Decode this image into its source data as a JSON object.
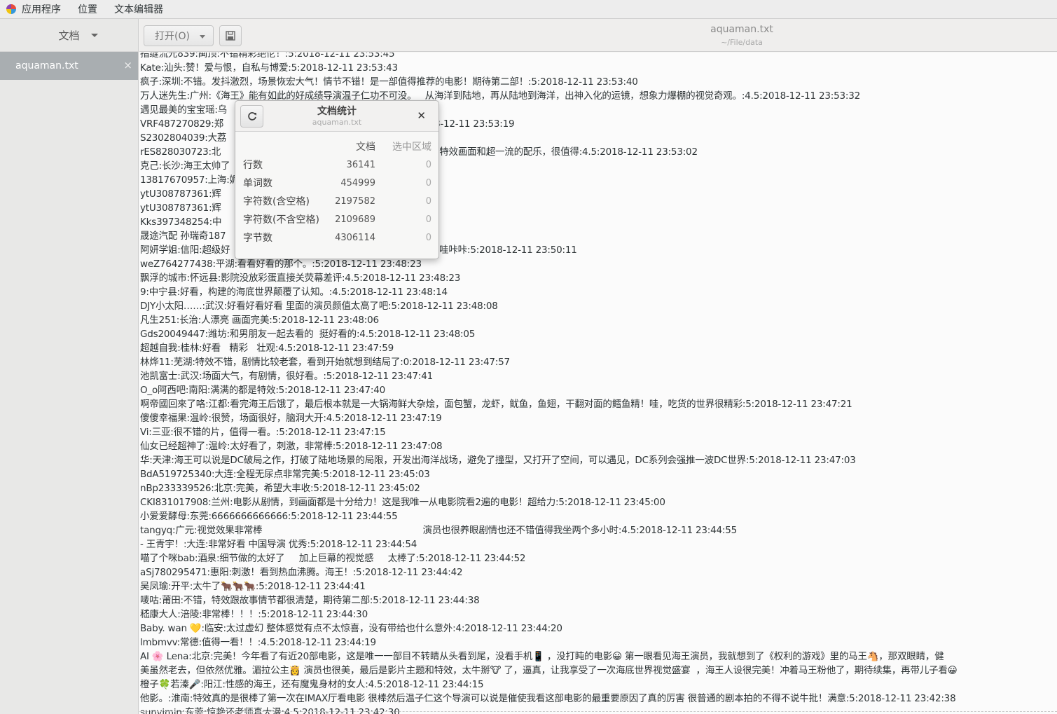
{
  "topbar": {
    "menus": [
      "应用程序",
      "位置",
      "文本编辑器"
    ]
  },
  "sidebar": {
    "header_label": "文档",
    "documents": [
      {
        "name": "aquaman.txt"
      }
    ]
  },
  "header": {
    "open_label": "打开(O)",
    "title": "aquaman.txt",
    "subtitle": "~/File/data"
  },
  "editor": {
    "lines": [
      "指缝流光839:闽顶:不错精彩绝伦！:5:2018-12-11 23:53:45",
      "Kate:汕头:赞！爱与恨，自私与博爱:5:2018-12-11 23:53:43",
      "疯子:深圳:不错。发抖激烈，场景恢宏大气！情节不错！是一部值得推荐的电影！期待第二部！:5:2018-12-11 23:53:40",
      "万人迷先生:广州:《海王》能有如此的好成绩导演温子仁功不可没。   从海洋到陆地，再从陆地到海洋，出神入化的运镜，想象力爆棚的视觉奇观。:4.5:2018-12-11 23:53:32",
      "遇见最美的宝宝瑶:乌                                            25",
      "VRF487270829:郑                                               影真不错，:5:2018-12-11 23:53:19",
      "S2302804039:大荔                                              23:53:07",
      "rES828030723:北                                               尼带水，加上精致的特效画面和超一流的配乐，很值得:4.5:2018-12-11 23:53:02",
      "克己:长沙:海王太帅了",
      "13817670957:上海:妮",
      "ytU308787361:辉                                               3:51:13",
      "ytU308787361:辉                                               3:51:07",
      "Kks397348254:中",
      "晟途汽配 孙瑞奇187                                            -12-11 23:50:17",
      "阿妍学姐:信阳:超级好                                          比较奈斯  强烈推荐   哇咔咔:5:2018-12-11 23:50:11",
      "weZ764277438:平湖:看看好看的那个。:5:2018-12-11 23:48:23",
      "飘浮的城市:怀远县:影院没放彩蛋直接关荧幕差评:4.5:2018-12-11 23:48:23",
      "9:中宁县:好看，构建的海底世界颠覆了认知。:4.5:2018-12-11 23:48:14",
      "DJY小太阳……:武汉:好看好看好看 里面的演员颜值太高了吧:5:2018-12-11 23:48:08",
      "凡生251:长治:人漂亮 画面完美:5:2018-12-11 23:48:06",
      "Gds20049447:潍坊:和男朋友一起去看的  挺好看的:4.5:2018-12-11 23:48:05",
      "超越自我:桂林:好看   精彩   壮观:4.5:2018-12-11 23:47:59",
      "林烨11:芜湖:特效不错，剧情比较老套，看到开始就想到结局了:0:2018-12-11 23:47:57",
      "池凯富士:武汉:场面大气，有剧情，很好看。:5:2018-12-11 23:47:41",
      "O_o阿西吧:南阳:满满的都是特效:5:2018-12-11 23:47:40",
      "啊帝國回來了咯:江都:看完海王后饿了，最后根本就是一大锅海鲜大杂烩，面包蟹，龙虾，鱿鱼，鱼翅，干翻对面的鳕鱼精！哇，吃货的世界很精彩:5:2018-12-11 23:47:21",
      "傻傻幸福果:温岭:很赞，场面很好，脑洞大开:4.5:2018-12-11 23:47:19",
      "Vi:三亚:很不错的片，值得一看。:5:2018-12-11 23:47:15",
      "仙女已经超神了:温岭:太好看了，刺激，非常棒:5:2018-12-11 23:47:08",
      "华:天津:海王可以说是DC破局之作，打破了陆地场景的局限，开发出海洋战场，避免了撞型，又打开了空间，可以遇见，DC系列会强推一波DC世界:5:2018-12-11 23:47:03",
      "BdA519725340:大连:全程无尿点非常完美:5:2018-12-11 23:45:03",
      "nBp233339526:北京:完美，希望大丰收:5:2018-12-11 23:45:02",
      "CKI831017908:兰州:电影从剧情，到画面都是十分给力！这是我唯一从电影院看2遍的电影！超给力:5:2018-12-11 23:45:00",
      "小爱爱酵母:东莞:6666666666666:5:2018-12-11 23:44:55",
      "tangyq:广元:视觉效果非常棒                                                        演员也很养眼剧情也还不错值得我坐两个多小时:4.5:2018-12-11 23:44:55",
      "- 王青宇！:大连:非常好看 中国导演 优秀:5:2018-12-11 23:44:54",
      "喵了个咪bab:酒泉:细节做的太好了     加上巨幕的视觉感     太棒了:5:2018-12-11 23:44:52",
      "aSj780295471:惠阳:刺激！看到热血沸腾。海王！:5:2018-12-11 23:44:42",
      "吴凤瑜:开平:太牛了🐂🐂🐂:5:2018-12-11 23:44:41",
      "唛咕:莆田:不错，特效跟故事情节都很清楚，期待第二部:5:2018-12-11 23:44:38",
      "嵇康大人:涪陵:非常棒！！！:5:2018-12-11 23:44:30",
      "Baby. wan 💛:临安:太过虚幻 整体感觉有点不太惊喜，没有带给也什么意外:4:2018-12-11 23:44:20",
      "lmbmvv:常德:值得一看！！:4.5:2018-12-11 23:44:19",
      "AI 🌸 Lena:北京:完美！今年看了有近20部电影，这是唯一一部目不转睛从头看到尾，没看手机📱 ，没打盹的电影😀 第一眼看见海王演员，我就想到了《权利的游戏》里的马王🐴，那双眼睛，健",
      "美虽然老去，但依然优雅。湄拉公主👸 演员也很美，最后是影片主题和特效，太牛掰🐮 了，逼真，让我享受了一次海底世界视觉盛宴  ，海王人设很完美！冲着马王粉他了，期待续集，再带儿子看😀",
      "橙子🍀若溱🎤:阳江:性感的海王，还有魔鬼身材的女人:4.5:2018-12-11 23:44:15",
      "他影。:淮南:特效真的是很棒了第一次在IMAX厅看电影 很棒然后温子仁这个导演可以说是催使我看这部电影的最重要原因了真的厉害 很普通的剧本拍的不得不说牛批！满意:5:2018-12-11 23:42:38",
      "sunyimin:东莞:惊艳还老师真大漫:4.5:2018-12-11 23:42:30"
    ]
  },
  "stats_dialog": {
    "title": "文档统计",
    "subtitle": "aquaman.txt",
    "col_document": "文档",
    "col_selection": "选中区域",
    "rows": [
      {
        "label": "行数",
        "doc": "36141",
        "sel": "0"
      },
      {
        "label": "单词数",
        "doc": "454999",
        "sel": "0"
      },
      {
        "label": "字符数(含空格)",
        "doc": "2197582",
        "sel": "0"
      },
      {
        "label": "字符数(不含空格)",
        "doc": "2109689",
        "sel": "0"
      },
      {
        "label": "字节数",
        "doc": "4306114",
        "sel": "0"
      }
    ]
  }
}
